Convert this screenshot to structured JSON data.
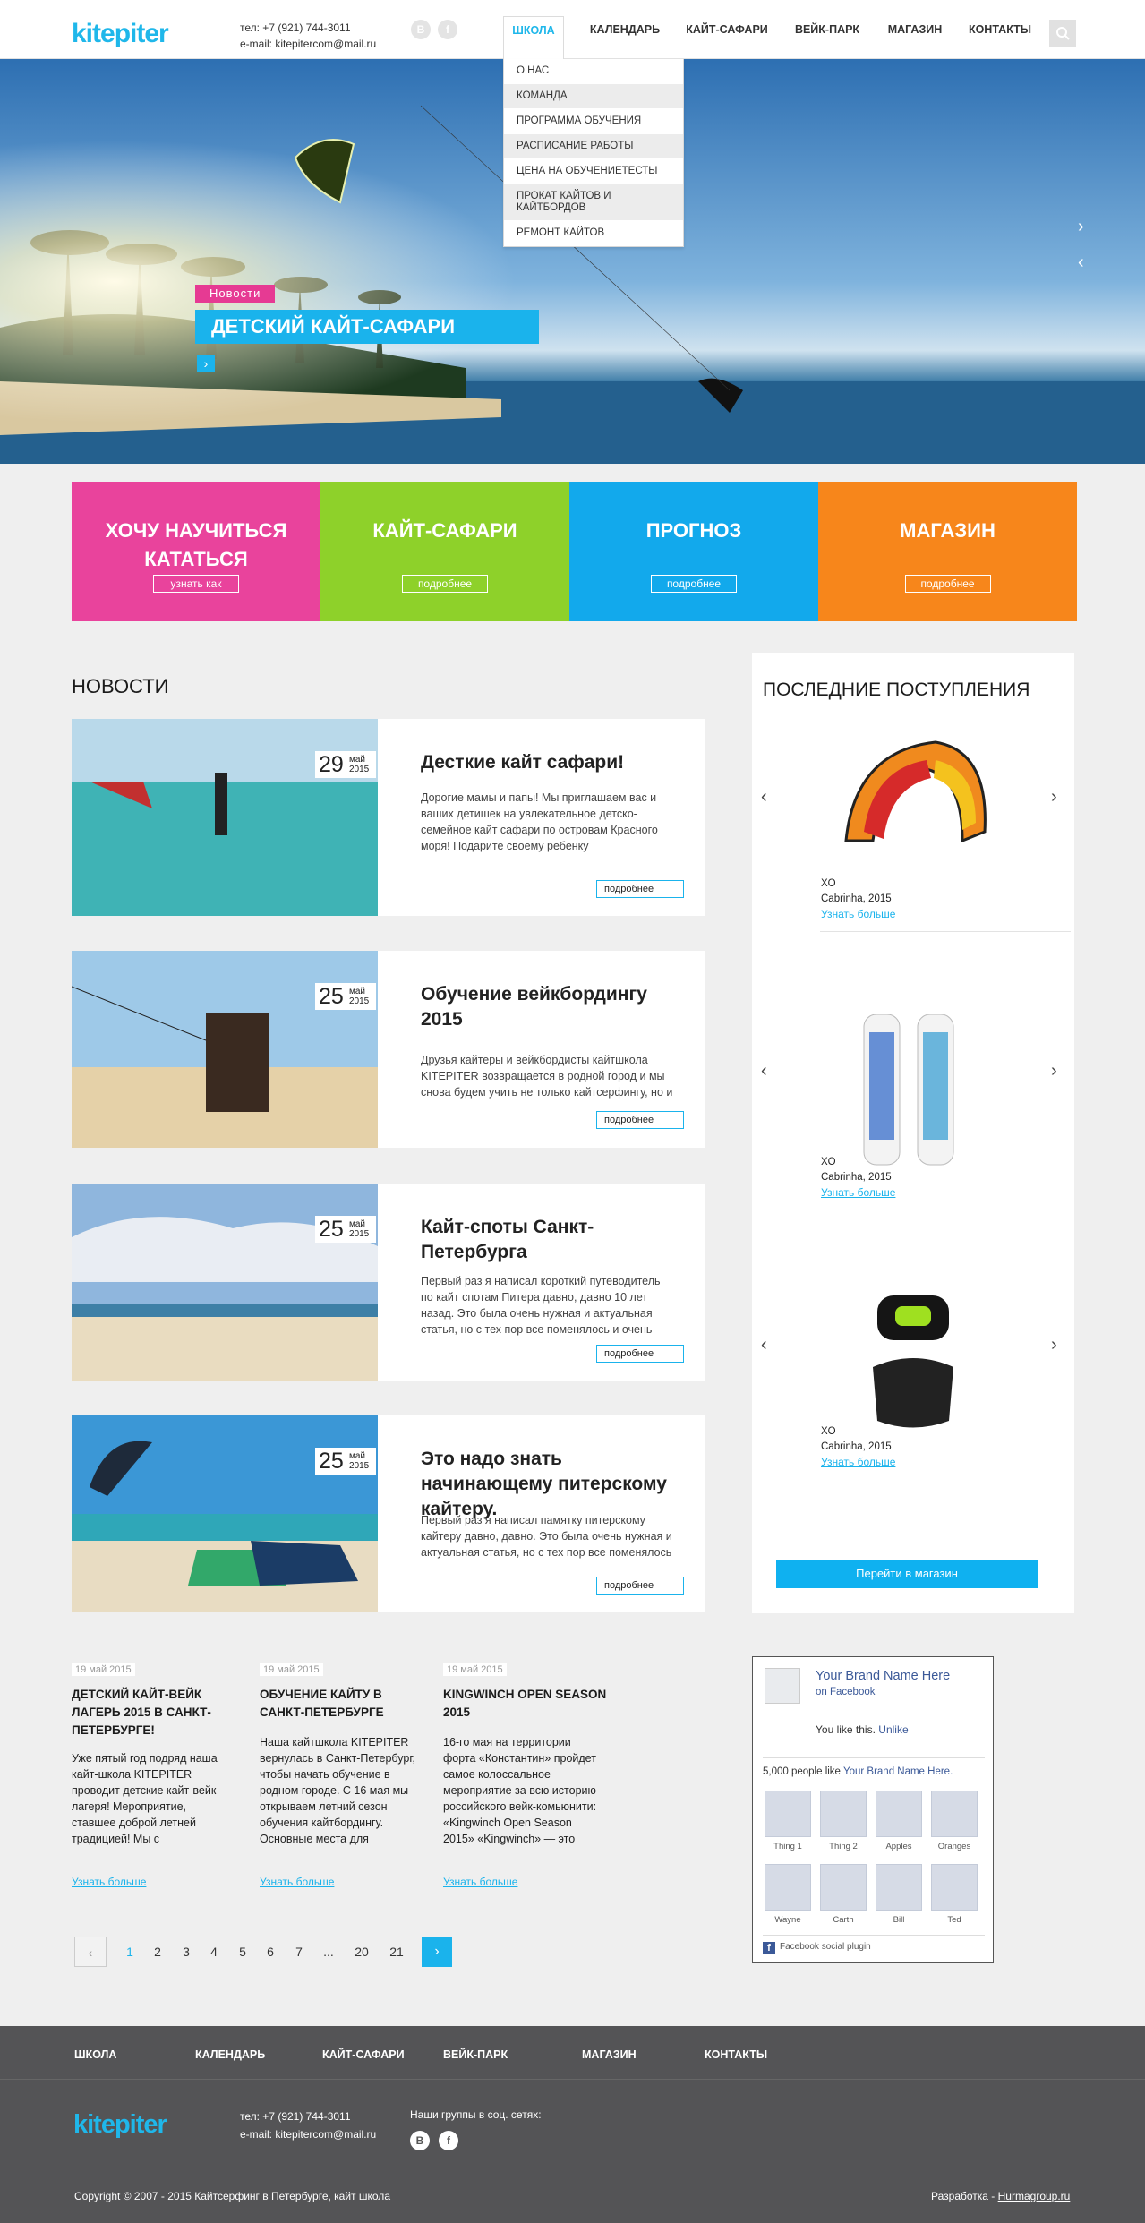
{
  "header": {
    "logo_text": "kitepiter",
    "phone": "тел: +7 (921) 744-3011",
    "email": "e-mail: kitepitercom@mail.ru",
    "social": [
      "В",
      "f"
    ],
    "nav": [
      "Школа",
      "Календарь",
      "Кайт-сафари",
      "Вейк-парк",
      "Магазин",
      "Контакты"
    ],
    "search_icon": "search-icon"
  },
  "dropdown": [
    "О нас",
    "Команда",
    "Программа обучения",
    "Расписание работы",
    "Цена на обучениетесты",
    "Прокат кайтов и кайтбордов",
    "Ремонт кайтов"
  ],
  "hero": {
    "tag": "Новости",
    "title": "Детский кайт-сафари",
    "arrow": "›",
    "next": "›",
    "prev": "‹"
  },
  "tiles": [
    {
      "title": "Хочу научиться кататься",
      "button": "узнать как",
      "color": "#e9439c"
    },
    {
      "title": "Кайт-сафари",
      "button": "подробнее",
      "color": "#8ed12a"
    },
    {
      "title": "Прогноз",
      "button": "подробнее",
      "color": "#12a9ec"
    },
    {
      "title": "Магазин",
      "button": "подробнее",
      "color": "#f7861b"
    }
  ],
  "news": {
    "heading": "Новости",
    "items": [
      {
        "day": "29",
        "month": "май",
        "year": "2015",
        "title": "Десткие кайт сафари!",
        "text": "Дорогие мамы и папы! Мы приглашаем вас и ваших детишек на увлекательное детско-семейное кайт сафари по островам Красного моря! Подарите своему ребенку",
        "more": "подробнее"
      },
      {
        "day": "25",
        "month": "май",
        "year": "2015",
        "title": "Обучение вейкбордингу 2015",
        "text": "Друзья кайтеры и вейкбордисты кайтшкола KITEPITER возвращается в родной город и мы снова будем учить не только кайтсерфингу, но и",
        "more": "подробнее"
      },
      {
        "day": "25",
        "month": "май",
        "year": "2015",
        "title": "Кайт-споты Санкт-Петербурга",
        "text": "Первый раз я написал короткий путеводитель по кайт спотам Питера давно, давно 10 лет назад. Это была очень нужная и актуальная статья, но с тех пор все поменялось и очень сильно! Кто хочет",
        "more": "подробнее"
      },
      {
        "day": "25",
        "month": "май",
        "year": "2015",
        "title": "Это надо знать начинающему питерскому кайтеру.",
        "text": "Первый раз я написал памятку питерскому кайтеру давно, давно. Это была очень нужная и актуальная статья, но с тех пор все поменялось и",
        "more": "подробнее"
      }
    ]
  },
  "products": {
    "heading": "Последние поступления",
    "items": [
      {
        "name": "XO",
        "sub": "Cabrinha, 2015",
        "link": "Узнать больше"
      },
      {
        "name": "XO",
        "sub": "Cabrinha, 2015",
        "link": "Узнать больше"
      },
      {
        "name": "XO",
        "sub": "Cabrinha, 2015",
        "link": "Узнать больше"
      }
    ],
    "arrow_left": "‹",
    "arrow_right": "›",
    "shop_button": "Перейти в магазин"
  },
  "bottom_news": [
    {
      "date": "19 май 2015",
      "title": "Детский кайт-вейк лагерь 2015 в Санкт-Петербурге!",
      "text": "Уже пятый год подряд наша кайт-школа KITEPITER проводит детские кайт-вейк лагеря! Мероприятие, ставшее доброй летней традицией! Мы с удовольствием тренируем детей и делимся с ними",
      "link": "Узнать больше"
    },
    {
      "date": "19 май 2015",
      "title": "Обучение кайту в Санкт-Петербурге",
      "text": "Наша кайтшкола KITEPITER вернулась в Санкт-Петербург, чтобы начать обучение в родном городе. С 16 мая мы открываем летний сезон обучения кайтбордингу. Основные места для обучения: Сестрорецкий Курорт, Большая",
      "link": "Узнать больше"
    },
    {
      "date": "19 май 2015",
      "title": "Kingwinch Open Season 2015",
      "text": "16-го мая на территории форта «Константин» пройдет самое колоссальное мероприятие за всю историю российского вейк-комьюнити: «Kingwinch Open Season 2015» «Kingwinch» — это Первый в России двухуровневый джиб-парк,",
      "link": "Узнать больше"
    }
  ],
  "pager": {
    "prev": "‹",
    "pages": [
      "1",
      "2",
      "3",
      "4",
      "5",
      "6",
      "7",
      "...",
      "20",
      "21"
    ],
    "next": "›"
  },
  "facebook": {
    "title": "Your Brand Name Here",
    "on": "on Facebook",
    "you_like": "You like this.",
    "unlike": "Unlike",
    "count_text": "5,000 people like",
    "count_brand": "Your Brand Name Here.",
    "people": [
      "Thing 1",
      "Thing 2",
      "Apples",
      "Oranges",
      "Wayne",
      "Carth",
      "Bill",
      "Ted"
    ],
    "plugin": "Facebook social plugin",
    "fb_letter": "f"
  },
  "footer": {
    "nav": [
      "Школа",
      "Календарь",
      "Кайт-сафари",
      "Вейк-парк",
      "Магазин",
      "Контакты"
    ],
    "logo_text": "kitepiter",
    "phone": "тел: +7 (921) 744-3011",
    "email": "e-mail: kitepitercom@mail.ru",
    "social_label": "Наши группы в соц. сетях:",
    "social": [
      "В",
      "f"
    ],
    "copyright": "Copyright © 2007 - 2015 Кайтсерфинг в Петербурге, кайт школа",
    "dev_label": "Разработка -",
    "dev_link": "Hurmagroup.ru"
  }
}
